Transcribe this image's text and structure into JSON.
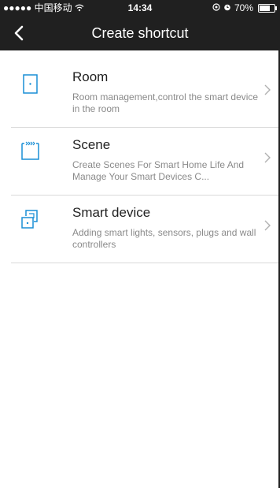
{
  "status": {
    "carrier": "●●●●● 中国移动",
    "time": "14:34",
    "battery_text": "70%",
    "battery_level": 0.7
  },
  "nav": {
    "title": "Create shortcut"
  },
  "items": [
    {
      "title": "Room",
      "desc": "Room management,control the smart device in the room",
      "icon": "door-icon"
    },
    {
      "title": "Scene",
      "desc": "Create Scenes For Smart Home Life And Manage Your Smart Devices C...",
      "icon": "scene-icon"
    },
    {
      "title": "Smart device",
      "desc": "Adding smart lights, sensors, plugs and wall controllers",
      "icon": "smart-device-icon"
    }
  ],
  "colors": {
    "bar": "#202020",
    "icon": "#1a8fd6",
    "divider": "#d9d9d9"
  }
}
